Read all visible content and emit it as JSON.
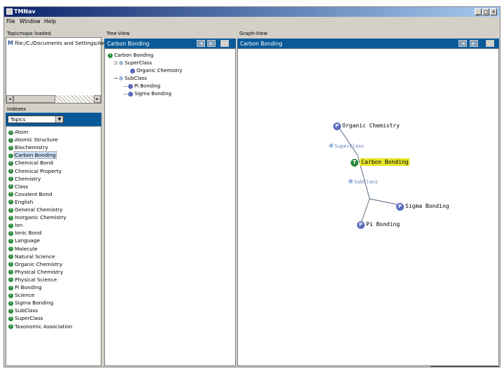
{
  "window": {
    "title": "TMNav"
  },
  "menu": {
    "items": [
      "File",
      "Window",
      "Help"
    ]
  },
  "topicmaps": {
    "header": "Topicmaps loaded",
    "entries": [
      "file:/C:/Documents and Settings/Aem"
    ]
  },
  "indexes": {
    "header": "Indexes",
    "dropdown_value": "Topics",
    "items": [
      "Atom",
      "Atomic Structure",
      "Biochemistry",
      "Carbon Bonding",
      "Chemical Bond",
      "Chemical Property",
      "Chemistry",
      "Class",
      "Covalent Bond",
      "English",
      "General Chemistry",
      "Inorganic Chemistry",
      "Ion",
      "Ionic Bond",
      "Language",
      "Molecule",
      "Natural Science",
      "Organic Chemistry",
      "Physical Chemistry",
      "Physical Science",
      "Pi Bonding",
      "Science",
      "Sigma Bonding",
      "SubClass",
      "SuperClass",
      "Taxonomic Association"
    ],
    "selected": "Carbon Bonding"
  },
  "tree_view": {
    "header": "Tree-View",
    "current": "Carbon Bonding",
    "root": "Carbon Bonding",
    "superclass_label": "SuperClass",
    "superclass_child": "Organic Chemistry",
    "subclass_label": "SubClass",
    "subclass_children": [
      "Pi Bonding",
      "Sigma Bonding"
    ]
  },
  "graph_view": {
    "header": "Graph-View",
    "current": "Carbon Bonding",
    "nodes": {
      "organic": "Organic Chemistry",
      "superclass": "SuperClass",
      "center": "Carbon Bonding",
      "subclass": "SubClass",
      "sigma": "Sigma Bonding",
      "pi": "Pi Bonding"
    },
    "center_letter": "T",
    "node_letter": "P"
  },
  "icons": {
    "back": "back-arrow-icon",
    "forward": "forward-arrow-icon"
  }
}
